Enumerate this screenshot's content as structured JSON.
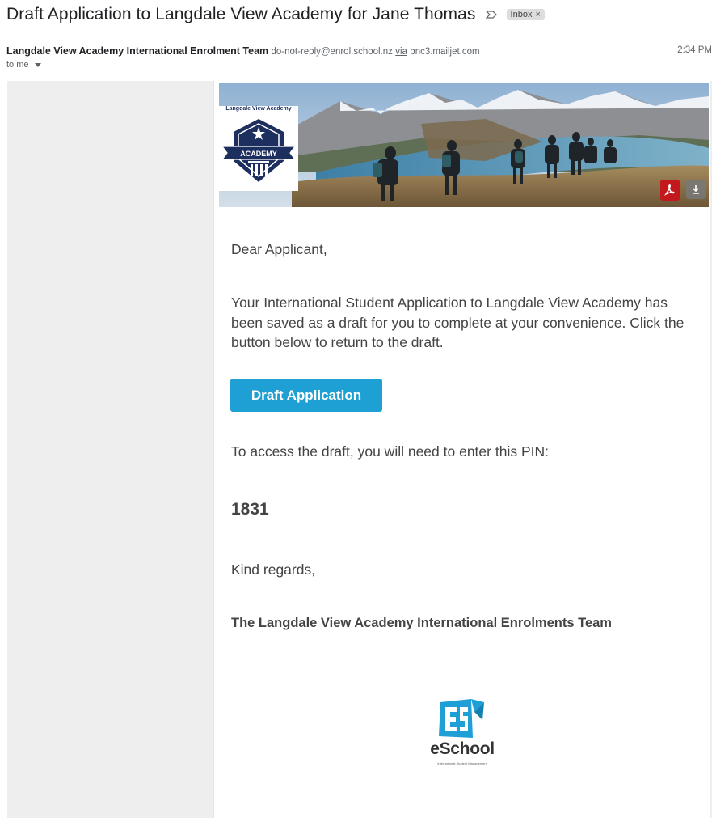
{
  "email": {
    "subject": "Draft Application to Langdale View Academy for Jane Thomas",
    "label": "Inbox",
    "label_close": "×",
    "sender_name": "Langdale View Academy International Enrolment Team",
    "sender_email": "do-not-reply@enrol.school.nz",
    "via_label": "via",
    "via_domain": "bnc3.mailjet.com",
    "time": "2:34 PM",
    "recipient": "to me"
  },
  "banner": {
    "logo_title": "Langdale View Academy",
    "logo_ribbon": "ACADEMY"
  },
  "body": {
    "greeting": "Dear Applicant,",
    "paragraph": "Your International Student Application to Langdale View Academy has been saved as a draft for you to complete at your convenience. Click the button below to return to the draft.",
    "button_label": "Draft Application",
    "pin_label": "To access the draft, you will need to enter this PIN:",
    "pin": "1831",
    "closing": "Kind regards,",
    "signature": "The Langdale View Academy International Enrolments Team"
  },
  "footer_logo": {
    "mark": "ES",
    "word": "eSchool",
    "tagline": "International Student Management"
  },
  "icons": {
    "importance": "importance-marker-icon",
    "pdf": "pdf-icon",
    "download": "download-icon",
    "caret": "caret-down-icon"
  },
  "colors": {
    "button": "#1ea0d4",
    "pdf": "#c4191c",
    "logo_navy": "#1d2f5e",
    "eschool_blue": "#1e9fd6"
  }
}
